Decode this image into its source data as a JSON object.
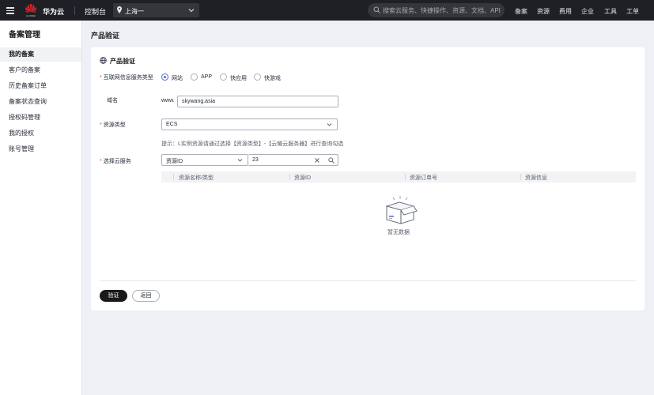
{
  "header": {
    "logo_text": "HUAWEI",
    "brand": "华为云",
    "console": "控制台",
    "region": "上海一",
    "search_placeholder": "搜索云服务、快捷操作、资源、文档、API",
    "nav": [
      "备案",
      "资源",
      "费用",
      "企业",
      "工具",
      "工单"
    ]
  },
  "sidebar": {
    "title": "备案管理",
    "items": [
      {
        "label": "我的备案",
        "active": true
      },
      {
        "label": "客户的备案",
        "active": false
      },
      {
        "label": "历史备案订单",
        "active": false
      },
      {
        "label": "备案状态查询",
        "active": false
      },
      {
        "label": "授权码管理",
        "active": false
      },
      {
        "label": "我的授权",
        "active": false
      },
      {
        "label": "账号管理",
        "active": false
      }
    ]
  },
  "page": {
    "title": "产品验证",
    "section_title": "产品验证"
  },
  "form": {
    "service_type_label": "互联网信息服务类型",
    "service_types": [
      "网站",
      "APP",
      "快应用",
      "快游戏"
    ],
    "selected_service_type": "网站",
    "domain_label": "域名",
    "domain_prefix": "www.",
    "domain_value": "skywang.asia",
    "resource_type_label": "资源类型",
    "resource_type_value": "ECS",
    "hint": "提示：L实例资源请通过选择【资源类型】-【云耀云服务器】进行查询勾选",
    "select_server_label": "选择云服务",
    "filter_field": "资源ID",
    "filter_value": "23"
  },
  "table": {
    "columns": [
      "资源名称/类型",
      "资源ID",
      "资源订单号",
      "资源信息"
    ],
    "empty_text": "暂无数据"
  },
  "actions": {
    "verify": "验证",
    "back": "返回"
  }
}
